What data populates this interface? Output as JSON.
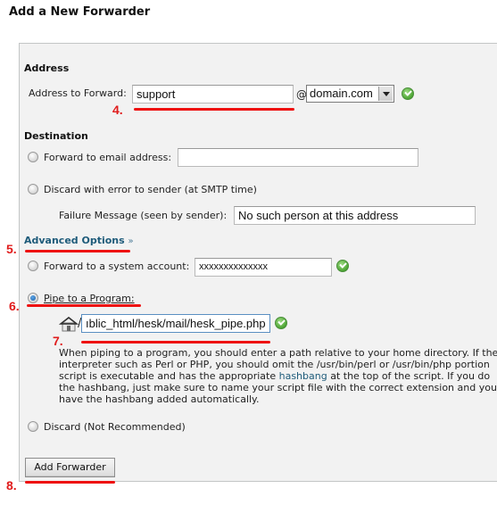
{
  "page": {
    "title": "Add a New Forwarder"
  },
  "address": {
    "heading": "Address",
    "forward_label": "Address to Forward:",
    "forward_value": "support",
    "at_symbol": "@",
    "domain_selected": "domain.com",
    "status_icon": "check-icon"
  },
  "destination": {
    "heading": "Destination",
    "forward_email": {
      "label": "Forward to email address:",
      "value": "",
      "checked": false
    },
    "discard_error": {
      "label": "Discard with error to sender (at SMTP time)",
      "checked": false,
      "failure_label": "Failure Message (seen by sender):",
      "failure_value": "No such person at this address"
    }
  },
  "advanced": {
    "link_label": "Advanced Options",
    "link_chevron": "»",
    "system_account": {
      "label": "Forward to a system account:",
      "value": "xxxxxxxxxxxxxx",
      "checked": false,
      "status_icon": "check-icon"
    },
    "pipe": {
      "label": "Pipe to a Program:",
      "checked": true,
      "path_prefix": "/",
      "path_value": "ıblic_html/hesk/mail/hesk_pipe.php",
      "status_icon": "check-icon",
      "help_lines": [
        "When piping to a program, you should enter a path relative to your home directory. If the",
        "interpreter such as Perl or PHP, you should omit the /usr/bin/perl or /usr/bin/php portion",
        "script is executable and has the appropriate ",
        "the hashbang, just make sure to name your script file with the correct extension and you",
        "have the hashbang added automatically."
      ],
      "help_link": "hashbang",
      "help_line3_after": " at the top of the script. If you do"
    },
    "discard": {
      "label": "Discard (Not Recommended)",
      "checked": false
    }
  },
  "actions": {
    "submit_label": "Add Forwarder"
  },
  "annotations": [
    "4.",
    "5.",
    "6.",
    "7.",
    "8."
  ],
  "colors": {
    "annotation": "#ee1111",
    "link": "#1e5b7a",
    "panel_bg": "#f2f2f2",
    "success": "#4da534"
  }
}
